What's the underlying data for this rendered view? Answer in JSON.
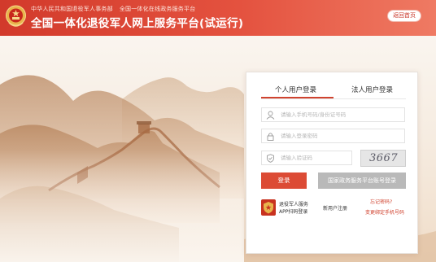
{
  "header": {
    "subline_left": "中华人民共和国退役军人事务部",
    "subline_right": "全国一体化在线政务服务平台",
    "title": "全国一体化退役军人网上服务平台(试运行)",
    "home_button": "返回首页"
  },
  "login": {
    "tabs": [
      {
        "label": "个人用户登录",
        "active": true
      },
      {
        "label": "法人用户登录",
        "active": false
      }
    ],
    "fields": {
      "username_placeholder": "请输入手机号码/身份证号码",
      "password_placeholder": "请输入登录密码",
      "captcha_placeholder": "请输入验证码"
    },
    "captcha_text": "3667",
    "login_button": "登录",
    "gov_login_button": "国家政务服务平台账号登录",
    "app_line1": "退役军人服务",
    "app_line2": "APP扫码登录",
    "register_link": "新用户注册",
    "forgot_link": "忘记密码?",
    "change_phone_link": "变更绑定手机号码"
  },
  "colors": {
    "brand_red": "#d23a2b",
    "login_button": "#dc4b35",
    "gov_button": "#b9b9b9"
  },
  "icons": {
    "emblem": "national-emblem-icon",
    "user": "user-icon",
    "password": "lock-icon",
    "captcha": "shield-check-icon",
    "app": "veteran-app-icon"
  }
}
